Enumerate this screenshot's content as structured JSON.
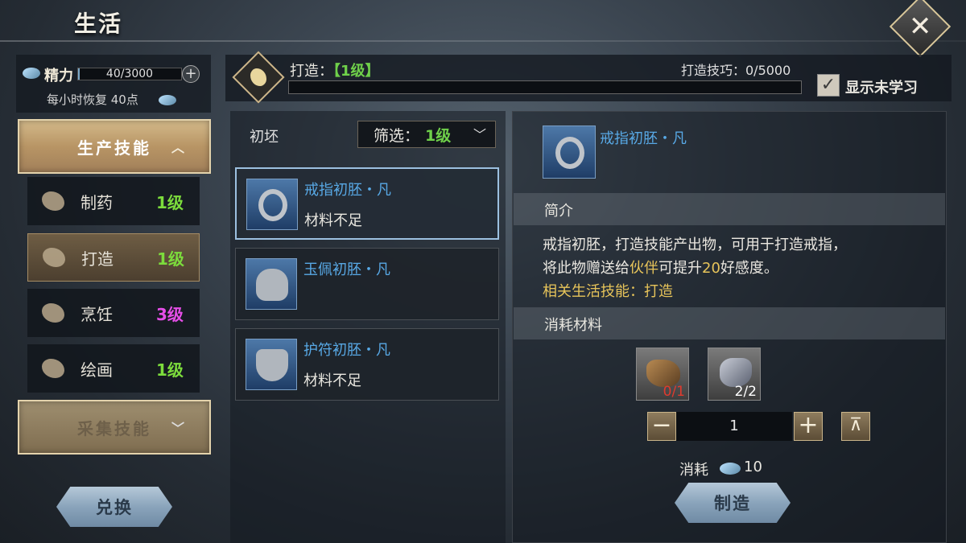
{
  "header": {
    "title": "生活",
    "close_icon": "✕"
  },
  "stamina": {
    "label": "精力",
    "value": "40/3000",
    "fill": 0.0133,
    "plus": "+",
    "recover_text": "每小时恢复 40点"
  },
  "categories": {
    "production": {
      "label": "生产技能",
      "chevron": "︿"
    },
    "gathering": {
      "label": "采集技能",
      "chevron": "﹀"
    }
  },
  "skills": [
    {
      "name": "制药",
      "level": "1级",
      "level_color": "#7cdc3c"
    },
    {
      "name": "打造",
      "level": "1级",
      "level_color": "#7cdc3c"
    },
    {
      "name": "烹饪",
      "level": "3级",
      "level_color": "#e64ee8"
    },
    {
      "name": "绘画",
      "level": "1级",
      "level_color": "#7cdc3c"
    }
  ],
  "buttons": {
    "exchange": "兑换",
    "craft": "制造"
  },
  "forge": {
    "label": "打造：",
    "level": "【1级】",
    "skill_text": "打造技巧：0/5000",
    "progress": 0,
    "show_unlearned": "显示未学习",
    "checked": "✓"
  },
  "list": {
    "header": "初坯",
    "filter_label": "筛选：",
    "filter_value": "1级",
    "filter_chevron": "﹀",
    "items": [
      {
        "name": "戒指初胚・凡",
        "status": "材料不足"
      },
      {
        "name": "玉佩初胚・凡",
        "status": ""
      },
      {
        "name": "护符初胚・凡",
        "status": "材料不足"
      }
    ]
  },
  "detail": {
    "name": "戒指初胚・凡",
    "intro_title": "简介",
    "desc_line1": "戒指初胚，打造技能产出物，可用于打造戒指，",
    "desc_line2_a": "将此物赠送给",
    "desc_line2_b": "伙伴",
    "desc_line2_c": "可提升",
    "desc_line2_d": "20",
    "desc_line2_e": "好感度。",
    "desc_line3": "相关生活技能：打造",
    "materials_title": "消耗材料",
    "materials": [
      {
        "count": "0/1",
        "count_color": "#e03a2e"
      },
      {
        "count": "2/2",
        "count_color": "#ffffff"
      }
    ],
    "minus": "−",
    "quantity": "1",
    "plus": "+",
    "max": "⊼",
    "cost_label": "消耗",
    "cost_value": "10"
  }
}
